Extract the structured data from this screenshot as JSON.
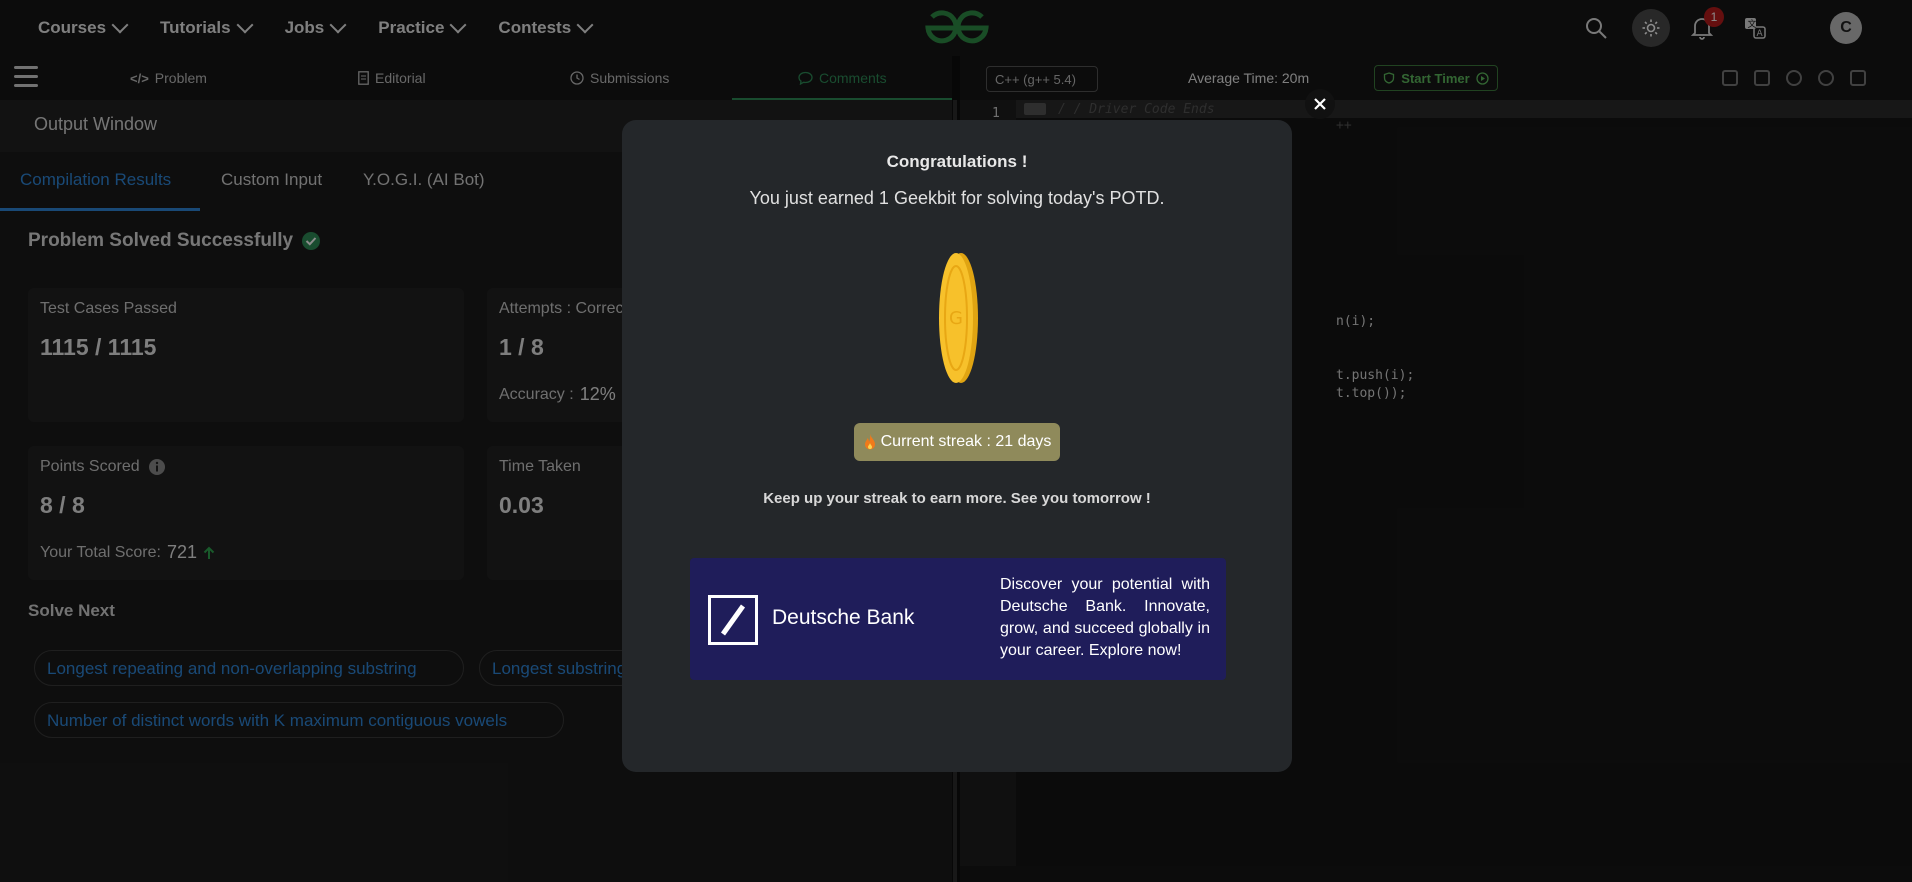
{
  "nav": {
    "items": [
      {
        "label": "Courses"
      },
      {
        "label": "Tutorials"
      },
      {
        "label": "Jobs"
      },
      {
        "label": "Practice"
      },
      {
        "label": "Contests"
      }
    ],
    "notification_count": "1",
    "avatar_initial": "C"
  },
  "problem_tabs": {
    "problem": "Problem",
    "editorial": "Editorial",
    "submissions": "Submissions",
    "comments": "Comments"
  },
  "output": {
    "title": "Output Window",
    "tabs": [
      "Compilation Results",
      "Custom Input",
      "Y.O.G.I. (AI Bot)"
    ],
    "status": "Problem Solved Successfully",
    "cards": {
      "test_cases_label": "Test Cases Passed",
      "test_cases_value": "1115 / 1115",
      "attempts_label": "Attempts : Correct / Total",
      "attempts_value": "1 / 8",
      "accuracy_label": "Accuracy :",
      "accuracy_value": "12%",
      "points_label": "Points Scored",
      "points_value": "8 / 8",
      "total_score_label": "Your Total Score:",
      "total_score_value": "721",
      "time_label": "Time Taken",
      "time_value": "0.03"
    },
    "solve_next_label": "Solve Next",
    "solve_next": [
      "Longest repeating and non-overlapping substring",
      "Longest substring",
      "Number of distinct words with K maximum contiguous vowels"
    ]
  },
  "editor": {
    "language": "C++ (g++ 5.4)",
    "average_time": "Average Time: 20m",
    "start_timer": "Start Timer",
    "line_number": "1",
    "code": [
      "/ / Driver Code Ends",
      "++",
      "n(i);",
      "t.push(i);",
      "t.top());"
    ]
  },
  "modal": {
    "title": "Congratulations !",
    "message": "You just earned 1 Geekbit for solving today's POTD.",
    "streak": "Current streak : 21 days",
    "keep_up": "Keep up your streak to earn more. See you tomorrow !",
    "ad_brand": "Deutsche Bank",
    "ad_text": "Discover your potential with Deutsche Bank. Innovate, grow, and succeed globally in your career. Explore now!"
  },
  "colors": {
    "accent_green": "#2e8b57",
    "accent_blue": "#2f86d8",
    "streak_bg": "#8f8a5b",
    "ad_bg": "#1f1d5a"
  }
}
